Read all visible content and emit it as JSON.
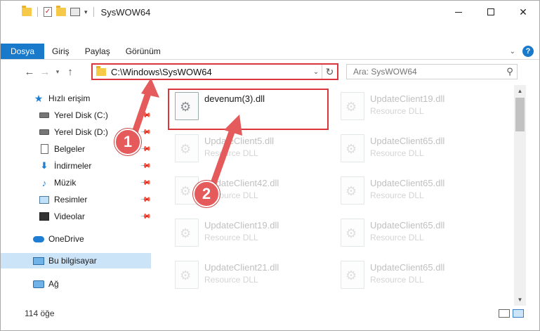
{
  "title": "SysWOW64",
  "ribbon": {
    "tabs": [
      {
        "label": "Dosya",
        "active": true
      },
      {
        "label": "Giriş",
        "active": false
      },
      {
        "label": "Paylaş",
        "active": false
      },
      {
        "label": "Görünüm",
        "active": false
      }
    ],
    "help": "?"
  },
  "address": {
    "path": "C:\\Windows\\SysWOW64",
    "refresh_glyph": "↻"
  },
  "search": {
    "placeholder": "Ara: SysWOW64"
  },
  "sidebar": {
    "items": [
      {
        "label": "Hızlı erişim",
        "icon": "star-icon",
        "pinned": false
      },
      {
        "label": "Yerel Disk (C:)",
        "icon": "drive-icon",
        "pinned": true
      },
      {
        "label": "Yerel Disk (D:)",
        "icon": "drive-icon",
        "pinned": true
      },
      {
        "label": "Belgeler",
        "icon": "documents-icon",
        "pinned": true
      },
      {
        "label": "İndirmeler",
        "icon": "downloads-icon",
        "pinned": true
      },
      {
        "label": "Müzik",
        "icon": "music-icon",
        "pinned": true
      },
      {
        "label": "Resimler",
        "icon": "pictures-icon",
        "pinned": true
      },
      {
        "label": "Videolar",
        "icon": "videos-icon",
        "pinned": true
      },
      {
        "label": "OneDrive",
        "icon": "cloud-icon",
        "pinned": false
      },
      {
        "label": "Bu bilgisayar",
        "icon": "computer-icon",
        "pinned": false,
        "selected": true
      },
      {
        "label": "Ağ",
        "icon": "network-icon",
        "pinned": false
      }
    ]
  },
  "files": {
    "left": [
      {
        "name": "devenum(3).dll",
        "type": "",
        "faded": false
      },
      {
        "name": "UpdateClient5.dll",
        "type": "Resource DLL",
        "faded": true
      },
      {
        "name": "UpdateClient42.dll",
        "type": "Resource DLL",
        "faded": true
      },
      {
        "name": "UpdateClient19.dll",
        "type": "Resource DLL",
        "faded": true
      },
      {
        "name": "UpdateClient21.dll",
        "type": "Resource DLL",
        "faded": true
      }
    ],
    "right": [
      {
        "name": "UpdateClient19.dll",
        "type": "Resource DLL",
        "faded": true
      },
      {
        "name": "UpdateClient65.dll",
        "type": "Resource DLL",
        "faded": true
      },
      {
        "name": "UpdateClient65.dll",
        "type": "Resource DLL",
        "faded": true
      },
      {
        "name": "UpdateClient65.dll",
        "type": "Resource DLL",
        "faded": true
      },
      {
        "name": "UpdateClient65.dll",
        "type": "Resource DLL",
        "faded": true
      }
    ]
  },
  "status": {
    "count": "114 öğe"
  },
  "annotations": {
    "callout1": "1",
    "callout2": "2",
    "color": "#e55a5a"
  },
  "colors": {
    "accent": "#1979ca",
    "highlight": "#d9363e",
    "selection": "#cce4f7"
  }
}
